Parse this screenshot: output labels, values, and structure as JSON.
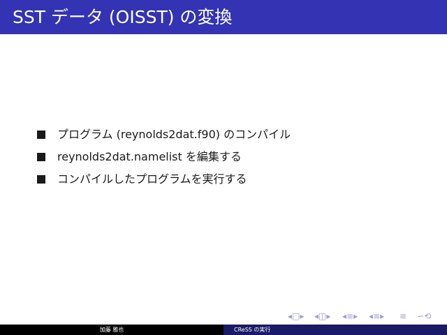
{
  "slide": {
    "title": "SST データ (OISST) の変換",
    "bullets": [
      "プログラム (reynolds2dat.f90) のコンパイル",
      "reynolds2dat.namelist を編集する",
      "コンパイルしたプログラムを実行する"
    ]
  },
  "navigation": {
    "frame_prev": "◂",
    "frame_icon": "□",
    "frame_next": "▸",
    "subsection_prev": "◂",
    "subsection_icon": "◫",
    "subsection_next": "▸",
    "section_prev": "◂",
    "section_icon": "≡",
    "section_next": "▸",
    "subsec2_prev": "◂",
    "subsec2_icon": "≡",
    "subsec2_next": "▸",
    "align_icon": "≡",
    "search_icon": "∽",
    "zoom_icon": "⟲"
  },
  "footer": {
    "author": "加藤 雅也",
    "short_title": "CReSS の実行"
  },
  "colors": {
    "title_bar": "#3333b3",
    "footer_left": "#000000",
    "footer_right": "#1a1a66",
    "nav": "#9b9bd6"
  }
}
